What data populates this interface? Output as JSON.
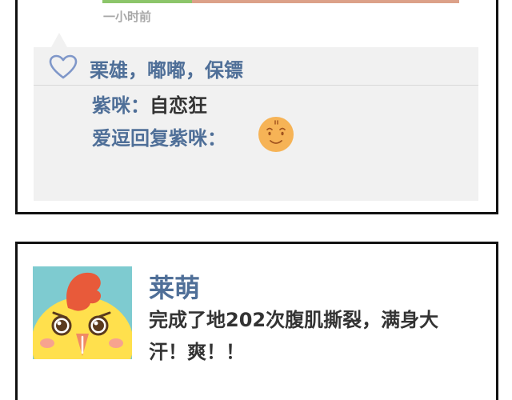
{
  "top_post": {
    "timestamp": "一小时前",
    "likes": "栗雄，嘟嘟，保镖",
    "comments": [
      {
        "author": "紫咪：",
        "text": "自恋狂"
      },
      {
        "author": "爱逗回复紫咪：",
        "text": "",
        "emoji": "smiling-face-emoji"
      }
    ]
  },
  "bottom_post": {
    "name": "莱萌",
    "text": "完成了地202次腹肌撕裂，满身大汗！爽！！",
    "avatar": "cartoon-yellow-chick-avatar"
  },
  "colors": {
    "name_blue": "#4f6f98",
    "comment_bg": "#f1f1f1",
    "body_text": "#333333",
    "timestamp_gray": "#a8a8a8",
    "avatar_bg": "#7ecbd0",
    "chick_yellow": "#ffe04d",
    "crest_red": "#e85a3a",
    "emoji_orange": "#f6b356"
  },
  "icons": {
    "heart": "heart-outline-icon",
    "emoji": "smiling-face-emoji"
  }
}
